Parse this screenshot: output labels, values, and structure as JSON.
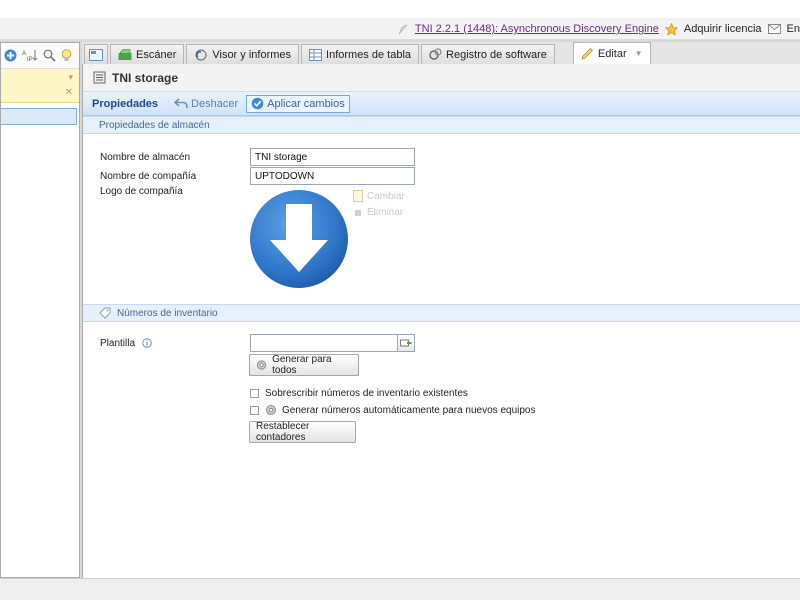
{
  "app": {
    "title_link": "TNI 2.2.1 (1448): Asynchronous Discovery Engine",
    "license_label": "Adquirir licencia",
    "mail_label": "En"
  },
  "tabs": [
    {
      "label": "Escáner",
      "icon": "scanner-icon"
    },
    {
      "label": "Visor y informes",
      "icon": "viewer-icon"
    },
    {
      "label": "Informes de tabla",
      "icon": "table-icon"
    },
    {
      "label": "Registro de software",
      "icon": "software-icon"
    },
    {
      "label": "Editar",
      "icon": "pencil-icon",
      "active": true
    }
  ],
  "document": {
    "title": "TNI storage"
  },
  "actionbar": {
    "title": "Propiedades",
    "undo_label": "Deshacer",
    "apply_label": "Aplicar cambios"
  },
  "storage_section": {
    "title": "Propiedades de almacén",
    "fields": {
      "storage_name_label": "Nombre de almacén",
      "storage_name_value": "TNI storage",
      "company_name_label": "Nombre de compañía",
      "company_name_value": "UPTODOWN",
      "logo_label": "Logo de compañía",
      "change_label": "Cambiar",
      "delete_label": "Eliminar"
    }
  },
  "inventory_section": {
    "title": "Números de inventario",
    "template_label": "Plantilla",
    "template_value": "",
    "generate_all_label": "Generar para todos",
    "overwrite_label": "Sobrescribir números de inventario existentes",
    "overwrite_checked": false,
    "auto_generate_label": "Generar números automáticamente para nuevos equipos",
    "auto_generate_checked": false,
    "reset_counters_label": "Restablecer contadores"
  },
  "colors": {
    "accent": "#1d4a84",
    "section_bg": "#e6f0fb",
    "logo_blue": "#2f76c9"
  }
}
